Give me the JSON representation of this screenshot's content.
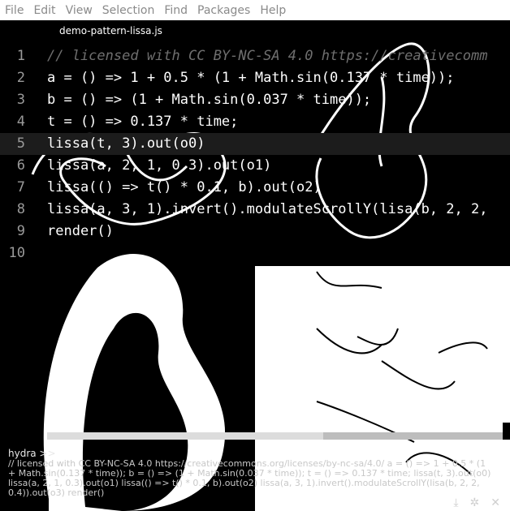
{
  "menu": [
    "File",
    "Edit",
    "View",
    "Selection",
    "Find",
    "Packages",
    "Help"
  ],
  "tab": {
    "title": "demo-pattern-lissa.js"
  },
  "editor": {
    "line_numbers": [
      "1",
      "2",
      "3",
      "4",
      "5",
      "6",
      "7",
      "8",
      "9",
      "10"
    ],
    "lines": [
      "// licensed with CC BY-NC-SA 4.0 https://creativecomm",
      "a = () => 1 + 0.5 * (1 + Math.sin(0.137 * time));",
      "b = () => (1 + Math.sin(0.037 * time));",
      "t = () => 0.137 * time;",
      "lissa(t, 3).out(o0)",
      "lissa(a, 2, 1, 0.3).out(o1)",
      "lissa(() => t() * 0.1, b).out(o2)",
      "lissa(a, 3, 1).invert().modulateScrollY(lisa(b, 2, 2,",
      "render()",
      ""
    ]
  },
  "console": {
    "title": "hydra >>",
    "text": "// licensed with CC BY-NC-SA 4.0 https://creativecommons.org/licenses/by-nc-sa/4.0/ a = () => 1 + 0.5 * (1 + Math.sin(0.137 * time)); b = () => (1 + Math.sin(0.037 * time)); t = () => 0.137 * time; lissa(t, 3).out(o0) lissa(a, 2, 1, 0.3).out(o1) lissa(() => t() * 0.1, b).out(o2) lissa(a, 3, 1).invert().modulateScrollY(lisa(b, 2, 2, 0.4)).out(o3) render()",
    "icons": [
      "download-icon",
      "settings-icon",
      "close-icon"
    ]
  },
  "colors": {
    "menubar_bg": "#ffffff",
    "menu_text": "#8a8a8a",
    "comment": "#6f6f6f",
    "keyword": "#c792ea",
    "number": "#ffb86c",
    "function": "#66ccff",
    "cursor": "#3fc0b0"
  }
}
